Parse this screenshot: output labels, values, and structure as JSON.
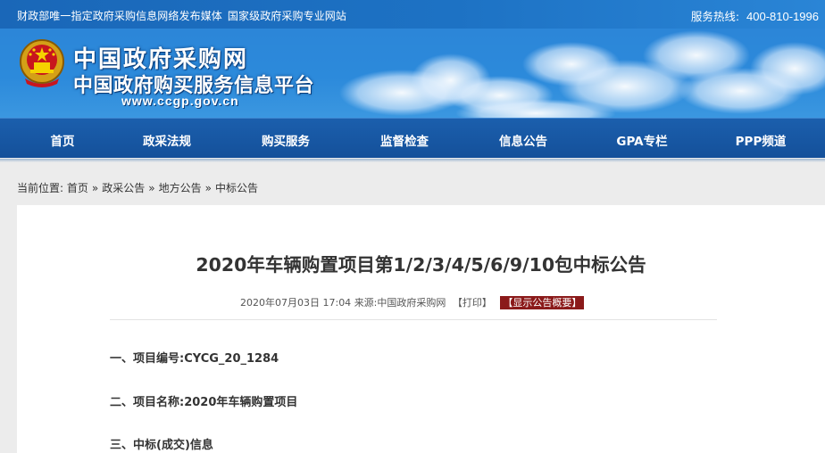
{
  "topbar": {
    "tagline_1": "财政部唯一指定政府采购信息网络发布媒体",
    "tagline_2": "国家级政府采购专业网站",
    "hotline_label": "服务热线:",
    "hotline_number": "400-810-1996"
  },
  "header": {
    "title": "中国政府采购网",
    "subtitle": "中国政府购买服务信息平台",
    "url": "www.ccgp.gov.cn",
    "emblem_icon": "national-emblem-icon"
  },
  "nav": {
    "items": [
      {
        "label": "首页"
      },
      {
        "label": "政采法规"
      },
      {
        "label": "购买服务"
      },
      {
        "label": "监督检查"
      },
      {
        "label": "信息公告"
      },
      {
        "label": "GPA专栏"
      },
      {
        "label": "PPP频道"
      }
    ]
  },
  "breadcrumb": {
    "prefix": "当前位置:",
    "items": [
      "首页",
      "政采公告",
      "地方公告",
      "中标公告"
    ],
    "separator": "»"
  },
  "article": {
    "title": "2020年车辆购置项目第1/2/3/4/5/6/9/10包中标公告",
    "datetime": "2020年07月03日 17:04",
    "source_label": "来源:",
    "source": "中国政府采购网",
    "print_label": "【打印】",
    "summary_label": "【显示公告概要】",
    "sections": [
      "一、项目编号:CYCG_20_1284",
      "二、项目名称:2020年车辆购置项目",
      "三、中标(成交)信息"
    ]
  },
  "colors": {
    "topbar": "#1a67b8",
    "banner": "#2c86d8",
    "nav": "#1b5fad",
    "summary_button": "#8b1a1a"
  }
}
